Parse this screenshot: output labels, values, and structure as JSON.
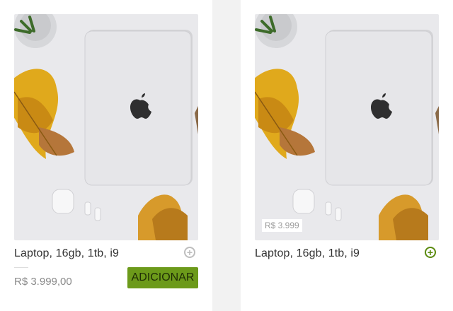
{
  "products": [
    {
      "title": "Laptop, 16gb, 1tb, i9",
      "price": "R$ 3.999,00",
      "add_button_label": "ADICIONAR",
      "add_icon": "plus-circle-icon",
      "add_icon_state": "inactive"
    },
    {
      "title": "Laptop, 16gb, 1tb, i9",
      "price_tag": "R$ 3.999",
      "add_icon": "plus-circle-icon",
      "add_icon_state": "active"
    }
  ],
  "colors": {
    "button_bg": "#6c9a1a",
    "button_text": "#1f2d05",
    "active_icon": "#5a8a0e",
    "inactive_icon": "#bdbdbd",
    "gutter": "#f2f2f2"
  }
}
